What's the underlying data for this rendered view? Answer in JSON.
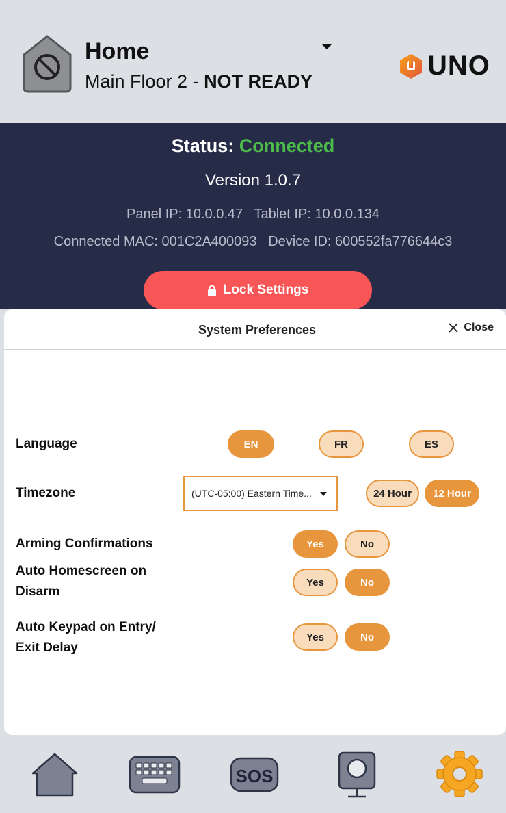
{
  "header": {
    "title": "Home",
    "subtitle_location": "Main Floor 2",
    "subtitle_separator": " - ",
    "subtitle_status": "NOT READY",
    "brand": "UNO",
    "home_icon": "blocked-home-icon",
    "dropdown_icon": "caret-down-icon"
  },
  "status": {
    "label": "Status: ",
    "value": "Connected",
    "value_color": "#4cbb4a",
    "version": "Version 1.0.7",
    "panel_ip_label": "Panel IP:",
    "panel_ip": "10.0.0.47",
    "tablet_ip_label": "Tablet IP:",
    "tablet_ip": "10.0.0.134",
    "mac_label": "Connected MAC:",
    "mac": "001C2A400093",
    "device_label": "Device ID:",
    "device_id": "600552fa776644c3",
    "lock_button": "Lock Settings",
    "lock_icon": "lock-icon"
  },
  "preferences": {
    "title": "System Preferences",
    "close_label": "Close",
    "language": {
      "label": "Language",
      "options": [
        "EN",
        "FR",
        "ES"
      ],
      "selected": "EN"
    },
    "timezone": {
      "label": "Timezone",
      "value": "(UTC-05:00) Eastern Time...",
      "formats": [
        "24 Hour",
        "12 Hour"
      ],
      "selected_format": "12 Hour"
    },
    "arming_confirmations": {
      "label": "Arming Confirmations",
      "yes": "Yes",
      "no": "No",
      "selected": "Yes"
    },
    "auto_homescreen": {
      "label_line1": "Auto Homescreen on",
      "label_line2": "Disarm",
      "yes": "Yes",
      "no": "No",
      "selected": "No"
    },
    "auto_keypad": {
      "label_line1": "Auto Keypad on Entry/",
      "label_line2": "Exit Delay",
      "yes": "Yes",
      "no": "No",
      "selected": "No"
    }
  },
  "nav": {
    "items": [
      {
        "icon": "home-icon"
      },
      {
        "icon": "keypad-icon"
      },
      {
        "icon": "sos-icon",
        "label": "SOS"
      },
      {
        "icon": "camera-icon"
      },
      {
        "icon": "settings-gear-icon",
        "active_color": "#f5a623"
      }
    ]
  },
  "colors": {
    "accent": "#e8963e",
    "panel_bg": "#262c48",
    "lock_button": "#f85557"
  }
}
